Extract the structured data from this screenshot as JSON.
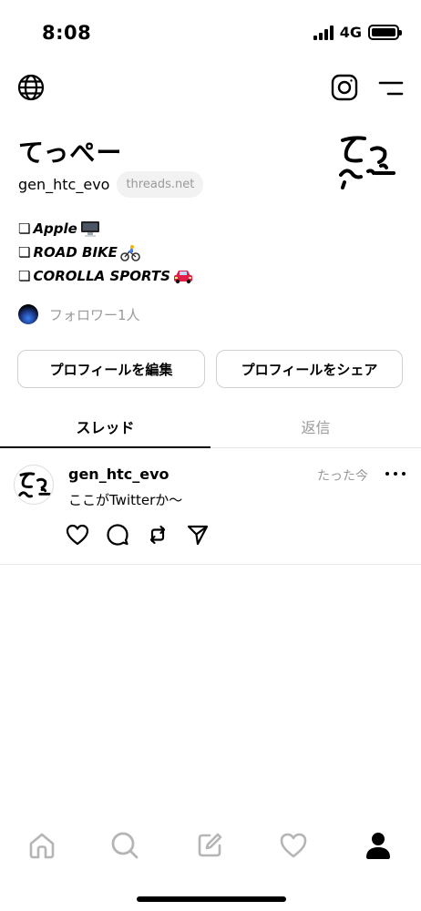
{
  "status_bar": {
    "time": "8:08",
    "network": "4G",
    "icons": [
      "signal-icon",
      "battery-icon"
    ]
  },
  "header": {
    "icons": [
      "globe-icon",
      "instagram-icon",
      "menu-icon"
    ]
  },
  "profile": {
    "name": "てっぺー",
    "handle": "gen_htc_evo",
    "domain_badge": "threads.net",
    "bio": [
      {
        "prefix": "❏",
        "text": "Apple",
        "emoji_icon": "desktop-computer-icon"
      },
      {
        "prefix": "❏",
        "text": "ROAD BIKE",
        "emoji_icon": "cyclist-icon"
      },
      {
        "prefix": "❏",
        "text": "COROLLA SPORTS",
        "emoji_icon": "car-icon"
      }
    ],
    "followers_text": "フォロワー1人"
  },
  "buttons": {
    "edit_profile": "プロフィールを編集",
    "share_profile": "プロフィールをシェア"
  },
  "tabs": [
    {
      "label": "スレッド",
      "active": true
    },
    {
      "label": "返信",
      "active": false
    }
  ],
  "post": {
    "username": "gen_htc_evo",
    "time": "たった今",
    "text": "ここがTwitterか〜",
    "actions": [
      "like-icon",
      "reply-icon",
      "repost-icon",
      "share-icon"
    ]
  },
  "bottom_nav": {
    "items": [
      "home-icon",
      "search-icon",
      "compose-icon",
      "activity-icon",
      "profile-icon"
    ],
    "active": "profile-icon"
  }
}
